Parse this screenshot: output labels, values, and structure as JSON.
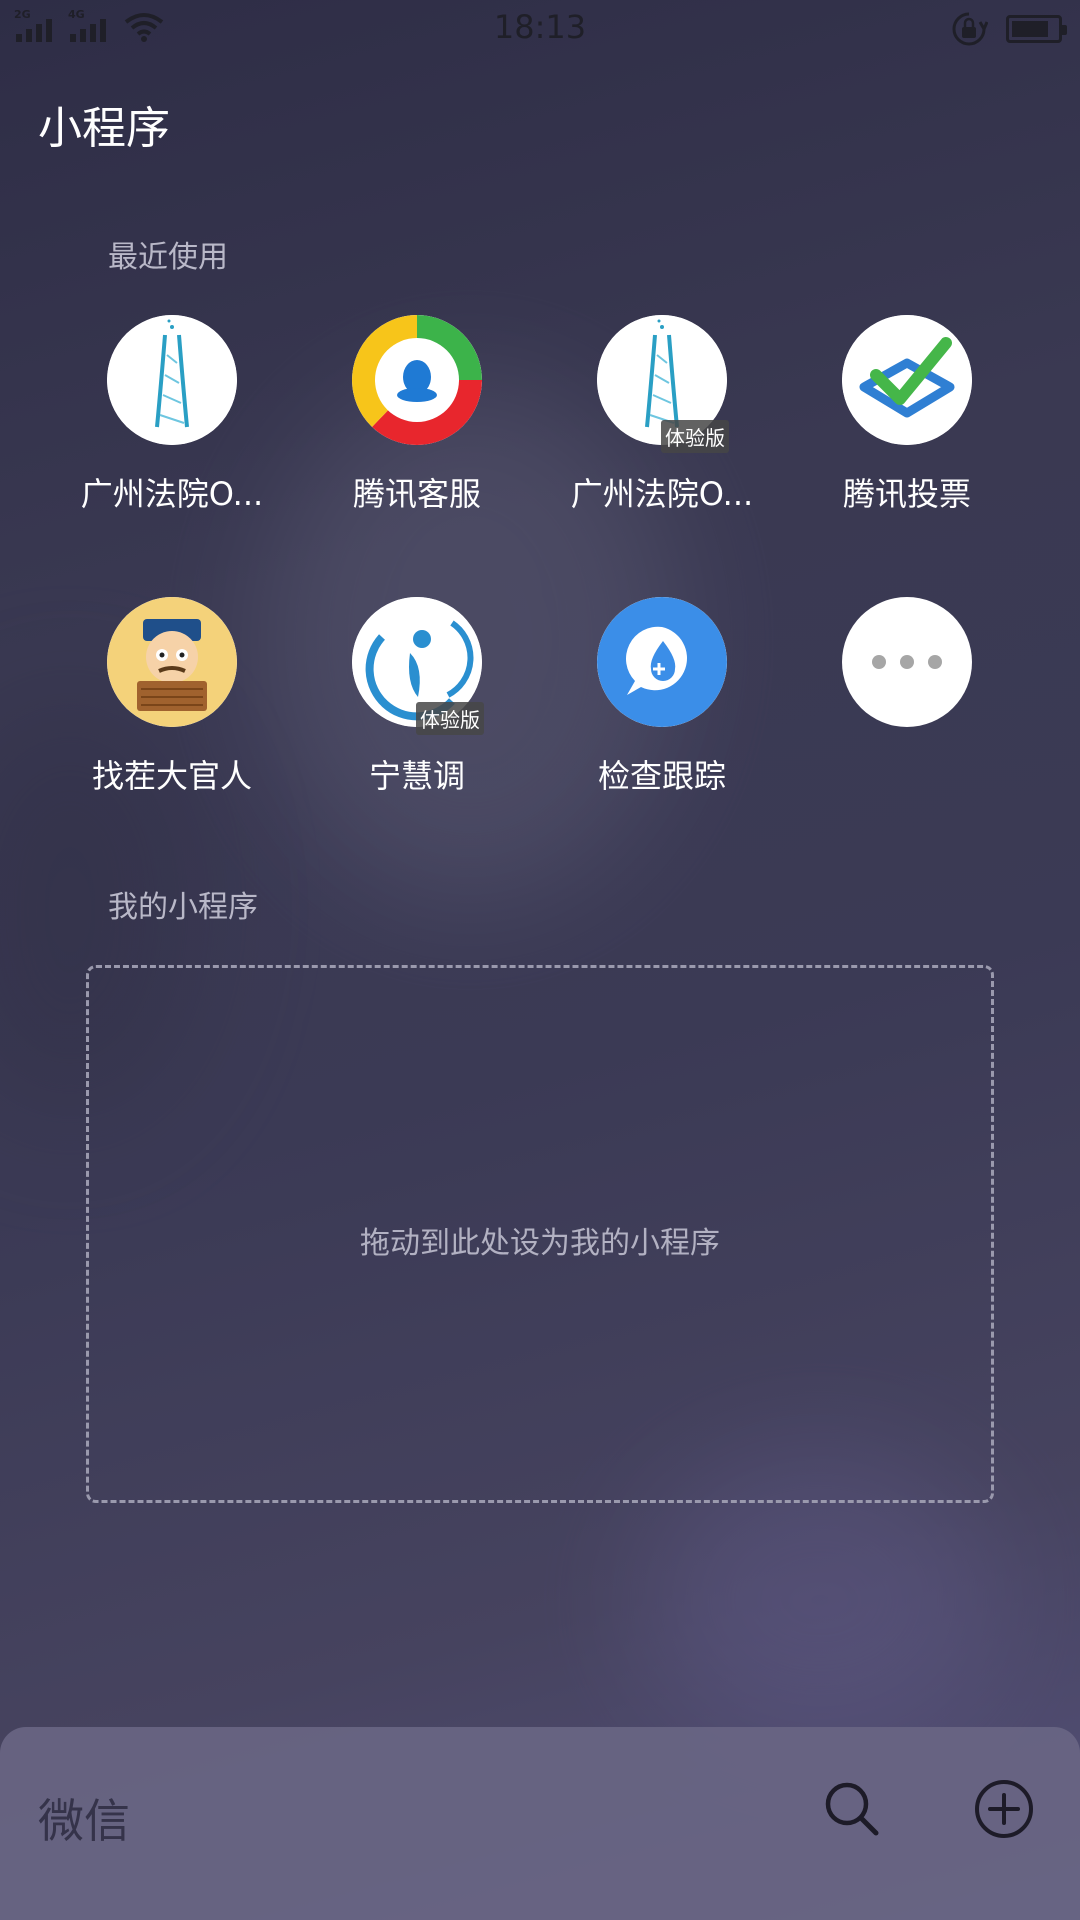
{
  "status_bar": {
    "sim1": "2G",
    "sim2": "4G",
    "time": "18:13",
    "icons": [
      "signal-icon",
      "wifi-icon",
      "rotation-lock-icon",
      "battery-icon"
    ]
  },
  "page": {
    "title": "小程序"
  },
  "recent": {
    "label": "最近使用",
    "apps": [
      {
        "name": "广州法院O...",
        "icon": "canton-tower-icon",
        "badge": ""
      },
      {
        "name": "腾讯客服",
        "icon": "tencent-service-icon",
        "badge": ""
      },
      {
        "name": "广州法院O...",
        "icon": "canton-tower-icon",
        "badge": "体验版"
      },
      {
        "name": "腾讯投票",
        "icon": "vote-check-icon",
        "badge": ""
      },
      {
        "name": "找茬大官人",
        "icon": "official-avatar-icon",
        "badge": ""
      },
      {
        "name": "宁慧调",
        "icon": "ninghui-logo-icon",
        "badge": "体验版"
      },
      {
        "name": "检查跟踪",
        "icon": "chat-drop-icon",
        "badge": ""
      },
      {
        "name": "",
        "icon": "more-icon",
        "badge": ""
      }
    ]
  },
  "mine": {
    "label": "我的小程序",
    "drop_hint": "拖动到此处设为我的小程序"
  },
  "bottom_bar": {
    "title": "微信",
    "icons": [
      "search-icon",
      "add-circle-icon"
    ]
  }
}
